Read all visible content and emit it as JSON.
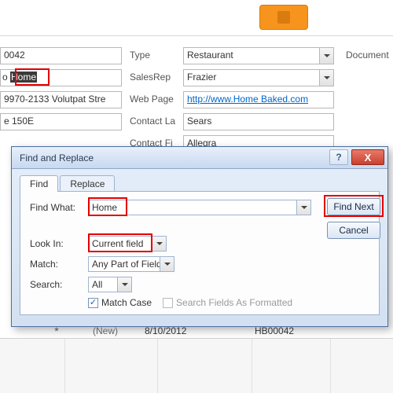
{
  "form": {
    "col1": {
      "r0": "0042",
      "r1_text": "Home",
      "r2": "9970-2133 Volutpat Stre",
      "r3": "e 150E"
    },
    "col2_labels": {
      "type": "Type",
      "salesrep": "SalesRep",
      "webpage": "Web Page",
      "contactla": "Contact La",
      "contactfi": "Contact Fi"
    },
    "col2_values": {
      "type": "Restaurant",
      "salesrep": "Frazier",
      "webpage": "http://www.Home Baked.com",
      "contactla": "Sears",
      "contactfi": "Allegra"
    },
    "document_label": "Document"
  },
  "dialog": {
    "title": "Find and Replace",
    "tab_find": "Find",
    "tab_replace": "Replace",
    "find_what_label": "Find What:",
    "find_what_value": "Home",
    "look_in_label": "Look In:",
    "look_in_value": "Current field",
    "match_label": "Match:",
    "match_value": "Any Part of Field",
    "search_label": "Search:",
    "search_value": "All",
    "match_case_label": "Match Case",
    "search_formatted_label": "Search Fields As Formatted",
    "btn_find_next": "Find Next",
    "btn_cancel": "Cancel",
    "help": "?",
    "close": "X"
  },
  "grid": {
    "new_label": "(New)",
    "date": "8/10/2012",
    "id": "HB00042",
    "star": "*"
  }
}
